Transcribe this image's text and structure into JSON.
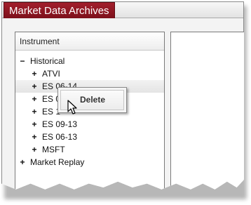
{
  "window": {
    "tab_title": "Market Data Archives"
  },
  "left_panel": {
    "header": "Instrument"
  },
  "tree": {
    "root1": {
      "toggle": "−",
      "label": "Historical"
    },
    "children": [
      {
        "toggle": "+",
        "label": "ATVI"
      },
      {
        "toggle": "+",
        "label": "ES 06-14"
      },
      {
        "toggle": "+",
        "label": "ES 0"
      },
      {
        "toggle": "+",
        "label": "ES 1"
      },
      {
        "toggle": "+",
        "label": "ES 09-13"
      },
      {
        "toggle": "+",
        "label": "ES 06-13"
      },
      {
        "toggle": "+",
        "label": "MSFT"
      }
    ],
    "root2": {
      "toggle": "+",
      "label": "Market Replay"
    }
  },
  "context_menu": {
    "delete_label": "Delete"
  },
  "colors": {
    "tab_bg": "#8f1823",
    "hover_row": "#e8e8e8"
  },
  "icons": {
    "cursor": "mouse-pointer-icon"
  }
}
